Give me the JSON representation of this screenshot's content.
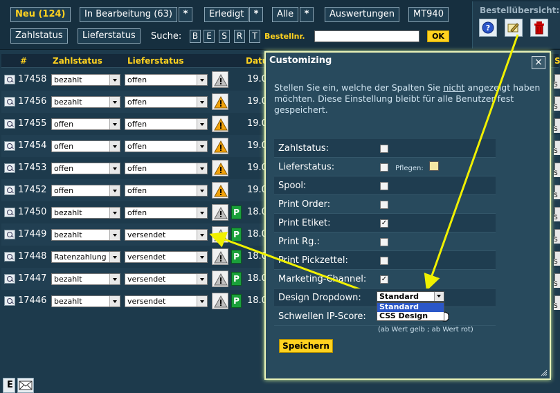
{
  "topbar": {
    "row1": {
      "neu": "Neu (124)",
      "in_bearbeitung": "In Bearbeitung (63)",
      "erledigt": "Erledigt",
      "alle": "Alle",
      "star": "*",
      "auswertungen": "Auswertungen",
      "mt940": "MT940"
    },
    "row2": {
      "zahlstatus": "Zahlstatus",
      "lieferstatus": "Lieferstatus",
      "search_label": "Suche:",
      "search_letters": [
        "B",
        "E",
        "S",
        "R",
        "T"
      ],
      "ordno_label": "Bestellnr.",
      "ordno_value": "",
      "ok": "OK"
    }
  },
  "overview": {
    "title": "Bestellübersicht:",
    "icons": [
      "help-icon",
      "customize-icon",
      "trash-icon"
    ]
  },
  "table": {
    "headers": {
      "num": "#",
      "zahlstatus": "Zahlstatus",
      "lieferstatus": "Lieferstatus",
      "date": "Datu"
    },
    "rows": [
      {
        "id": "17458",
        "zahl": "bezahlt",
        "liefer": "offen",
        "date": "19.0",
        "warn": "gray",
        "p": false
      },
      {
        "id": "17456",
        "zahl": "bezahlt",
        "liefer": "offen",
        "date": "19.0",
        "warn": "orange",
        "p": false
      },
      {
        "id": "17455",
        "zahl": "offen",
        "liefer": "offen",
        "date": "19.0",
        "warn": "orange",
        "p": false
      },
      {
        "id": "17454",
        "zahl": "offen",
        "liefer": "offen",
        "date": "19.0",
        "warn": "orange",
        "p": false
      },
      {
        "id": "17453",
        "zahl": "offen",
        "liefer": "offen",
        "date": "19.0",
        "warn": "orange",
        "p": false
      },
      {
        "id": "17452",
        "zahl": "offen",
        "liefer": "offen",
        "date": "19.0",
        "warn": "orange",
        "p": false
      },
      {
        "id": "17450",
        "zahl": "bezahlt",
        "liefer": "offen",
        "date": "18.0",
        "warn": "gray",
        "p": true,
        "p_label": "P"
      },
      {
        "id": "17449",
        "zahl": "bezahlt",
        "liefer": "versendet",
        "date": "18.0",
        "warn": "gray",
        "p": true,
        "p_label": "P"
      },
      {
        "id": "17448",
        "zahl": "Ratenzahlung",
        "liefer": "versendet",
        "date": "18.0",
        "warn": "gray",
        "p": true,
        "p_label": "P"
      },
      {
        "id": "17447",
        "zahl": "bezahlt",
        "liefer": "versendet",
        "date": "18.0",
        "warn": "gray",
        "p": true,
        "p_label": "P"
      },
      {
        "id": "17446",
        "zahl": "bezahlt",
        "liefer": "versendet",
        "date": "18.0",
        "warn": "gray",
        "p": true,
        "p_label": "P"
      }
    ],
    "right_labels": [
      "S",
      "S",
      "S",
      "S",
      "S",
      "S",
      "S",
      "S",
      "S",
      "S",
      "S",
      "S"
    ],
    "footer_icon_text": "E"
  },
  "dialog": {
    "title": "Customizing",
    "close": "×",
    "desc_before": "Stellen Sie ein, welche der Spalten Sie ",
    "desc_nicht": "nicht",
    "desc_after": " angezeigt haben möchten. Diese Einstellung bleibt für alle Benutzer fest gespeichert.",
    "options": [
      {
        "label": "Zahlstatus:",
        "checked": false
      },
      {
        "label": "Lieferstatus:",
        "checked": false,
        "extra": "Pflegen:"
      },
      {
        "label": "Spool:",
        "checked": false
      },
      {
        "label": "Print Order:",
        "checked": false
      },
      {
        "label": "Print Etiket:",
        "checked": true
      },
      {
        "label": "Print Rg.:",
        "checked": false
      },
      {
        "label": "Print Pickzettel:",
        "checked": false
      },
      {
        "label": "Marketing-Channel:",
        "checked": true
      },
      {
        "label": "Design Dropdown:",
        "select": "Standard"
      },
      {
        "label": "Schwellen IP-Score:"
      }
    ],
    "check_mark": "✓",
    "dropdown_options": [
      "Standard",
      "CSS Design"
    ],
    "threshold_hint": "(ab Wert gelb ; ab Wert rot)",
    "save": "Speichern"
  },
  "colors": {
    "accent": "#ffd21f",
    "background": "#1d3a4c",
    "annotation": "#f0f000",
    "dialog_glow": "#d8f59b"
  }
}
